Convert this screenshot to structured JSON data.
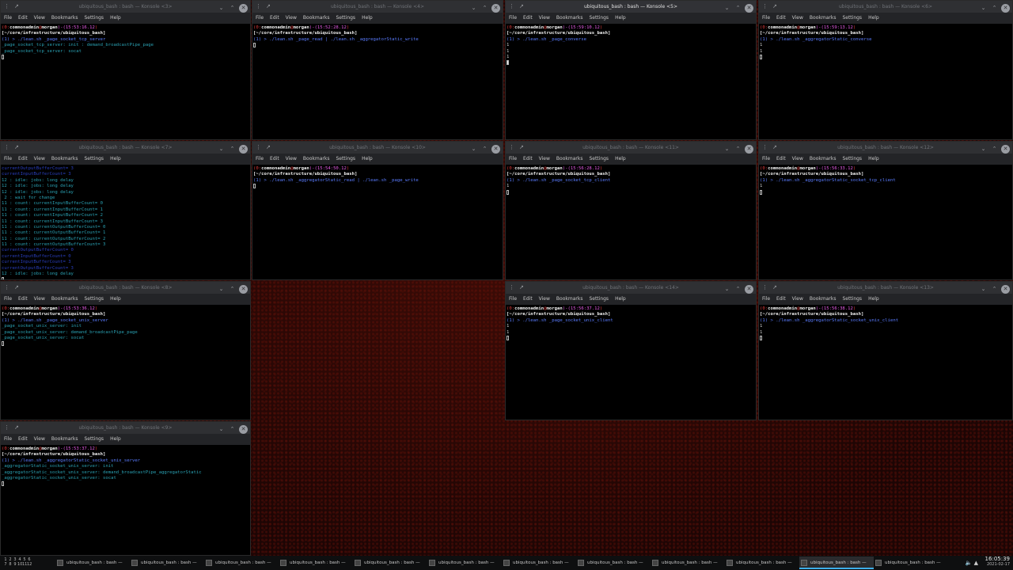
{
  "menu": [
    "File",
    "Edit",
    "View",
    "Bookmarks",
    "Settings",
    "Help"
  ],
  "prompt": {
    "user": "commonadmin",
    "at": "@",
    "host": "morgan",
    "path": "[~/core/infrastructure/ubiquitous_bash]"
  },
  "windows": [
    {
      "title": "ubiquitous_bash : bash — Konsole <3>",
      "time": "15:53:16.12",
      "lines": [
        "(1) > ./lean.sh _page_socket_tcp_server",
        "_page_socket_tcp_server: init : demand_broadcastPipe_page",
        "_page_socket_tcp_server: socat"
      ]
    },
    {
      "title": "ubiquitous_bash : bash — Konsole <4>",
      "time": "15:52:28.12",
      "lines": [
        "(1) > ./lean.sh _page_read | ./lean.sh _aggregatorStatic_write"
      ]
    },
    {
      "title": "ubiquitous_bash : bash — Konsole <5>",
      "time": "15:59:10.12",
      "lines": [
        "(1) > ./lean.sh _page_converse",
        "1",
        "1",
        "1"
      ]
    },
    {
      "title": "ubiquitous_bash : bash — Konsole <6>",
      "time": "15:59:13.12",
      "lines": [
        "(1) > ./lean.sh _aggregatorStatic_converse",
        "1",
        "1"
      ]
    },
    {
      "title": "ubiquitous_bash : bash — Konsole <7>",
      "lines": [
        "currentOutputBufferCount= 3",
        "currentInputBufferCount= 3",
        "12 : idle: jobs: long delay",
        "12 : idle: jobs: long delay",
        "12 : idle: jobs: long delay",
        " 2 : wait for change",
        "11 : count: currentInputBufferCount= 0",
        "11 : count: currentInputBufferCount= 1",
        "11 : count: currentInputBufferCount= 2",
        "11 : count: currentInputBufferCount= 3",
        "11 : count: currentOutputBufferCount= 0",
        "11 : count: currentOutputBufferCount= 1",
        "11 : count: currentOutputBufferCount= 2",
        "11 : count: currentOutputBufferCount= 3",
        "currentOutputBufferCount= 0",
        "currentInputBufferCount= 0",
        "currentInputBufferCount= 3",
        "currentOutputBufferCount= 3",
        "12 : idle: jobs: long delay"
      ]
    },
    {
      "title": "ubiquitous_bash : bash — Konsole <10>",
      "time": "15:54:50.12",
      "lines": [
        "(1) > ./lean.sh _aggregatorStatic_read | ./lean.sh _page_write"
      ]
    },
    {
      "title": "ubiquitous_bash : bash — Konsole <11>",
      "time": "15:56:28.12",
      "lines": [
        "(1) > ./lean.sh _page_socket_tcp_client",
        "1"
      ]
    },
    {
      "title": "ubiquitous_bash : bash — Konsole <12>",
      "time": "15:56:33.12",
      "lines": [
        "(1) > ./lean.sh _aggregatorStatic_socket_tcp_client",
        "1"
      ]
    },
    {
      "title": "ubiquitous_bash : bash — Konsole <8>",
      "time": "15:53:36.12",
      "lines": [
        "(1) > ./lean.sh _page_socket_unix_server",
        "_page_socket_unix_server: init",
        "_page_socket_unix_server: demand_broadcastPipe_page",
        "_page_socket_unix_server: socat"
      ]
    },
    {
      "title": "ubiquitous_bash : bash — Konsole <14>",
      "time": "15:56:37.12",
      "lines": [
        "(1) > ./lean.sh _page_socket_unix_client",
        "1",
        "1"
      ]
    },
    {
      "title": "ubiquitous_bash : bash — Konsole <13>",
      "time": "15:56:38.12",
      "lines": [
        "(1) > ./lean.sh _aggregatorStatic_socket_unix_client",
        "1",
        "1"
      ]
    },
    {
      "title": "ubiquitous_bash : bash — Konsole <9>",
      "time": "15:53:37.12",
      "lines": [
        "(1) > ./lean.sh _aggregatorStatic_socket_unix_server",
        "_aggregatorStatic_socket_unix_server: init",
        "_aggregatorStatic_socket_unix_server: demand_broadcastPipe_aggregatorStatic",
        "_aggregatorStatic_socket_unix_server: socat"
      ]
    }
  ],
  "taskbar": {
    "pager": [
      "1",
      "2",
      "3",
      "4",
      "5",
      "6",
      "7",
      "8",
      "9",
      "10",
      "11",
      "12"
    ],
    "task_label": "ubiquitous_bash : bash —",
    "clock": "16:05:39",
    "date": "2021-02-17"
  }
}
